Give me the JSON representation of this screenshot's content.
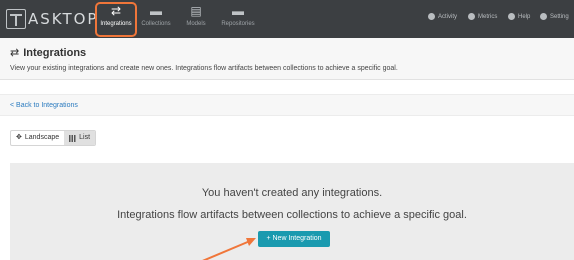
{
  "brand": {
    "logo_text": "ASKTOP"
  },
  "nav": {
    "items": [
      {
        "label": "Integrations",
        "icon": "⇄"
      },
      {
        "label": "Collections",
        "icon": "▬"
      },
      {
        "label": "Models",
        "icon": "▤"
      },
      {
        "label": "Repositories",
        "icon": "▬"
      }
    ],
    "right": [
      {
        "label": "Activity",
        "icon": "bell-icon"
      },
      {
        "label": "Metrics",
        "icon": "gauge-icon"
      },
      {
        "label": "Help",
        "icon": "help-icon"
      },
      {
        "label": "Setting",
        "icon": "gear-icon"
      }
    ]
  },
  "header": {
    "title": "Integrations",
    "subtitle": "View your existing integrations and create new ones. Integrations flow artifacts between collections to achieve a specific goal."
  },
  "back_link": "< Back to Integrations",
  "view_toggle": {
    "landscape_label": "Landscape",
    "list_label": "List",
    "selected": "List"
  },
  "empty_state": {
    "line1": "You haven't created any integrations.",
    "line2": "Integrations flow artifacts between collections to achieve a specific goal.",
    "button_label": "+ New Integration"
  },
  "colors": {
    "nav_bg": "#3c3f42",
    "accent": "#1a9aaf",
    "highlight": "#f0763a",
    "link": "#2b7bbf"
  }
}
